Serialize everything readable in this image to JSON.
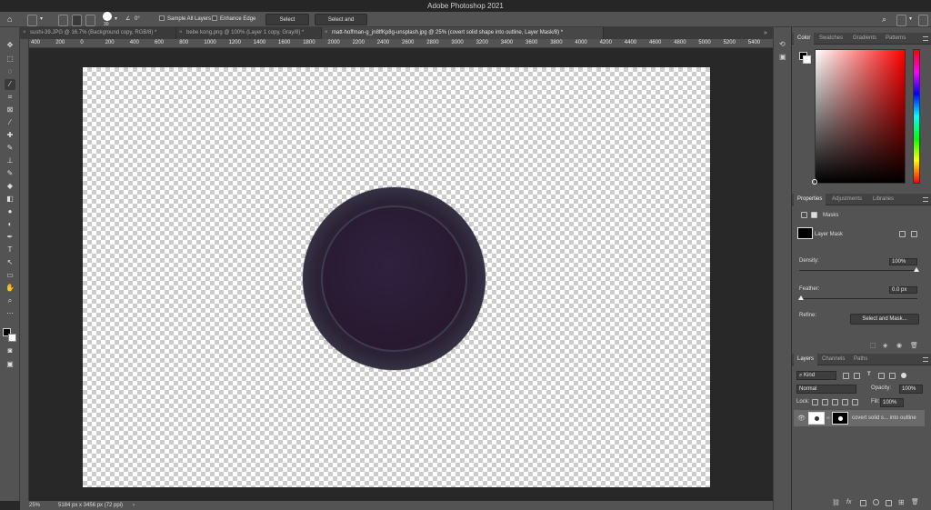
{
  "app": {
    "title": "Adobe Photoshop 2021"
  },
  "options": {
    "brush_size": "30",
    "angle": "0°",
    "sample_all_layers": "Sample All Layers",
    "enhance_edge": "Enhance Edge",
    "select_subject": "Select Subject",
    "select_and_mask": "Select and Mask..."
  },
  "tabs": [
    {
      "label": "sushi-39.JPG @ 16.7% (Background copy, RGB/8) *"
    },
    {
      "label": "bebe kong.png @ 100% (Layer 1 copy, Gray/8) *"
    },
    {
      "label": "matt-hoffman-g_jn8lfKp8g-unsplash.jpg @ 25% (covert solid shape into outline, Layer Mask/8) *"
    }
  ],
  "ruler_ticks": [
    "400",
    "200",
    "0",
    "200",
    "400",
    "600",
    "800",
    "1000",
    "1200",
    "1400",
    "1600",
    "1800",
    "2000",
    "2200",
    "2400",
    "2600",
    "2800",
    "3000",
    "3200",
    "3400",
    "3600",
    "3800",
    "4000",
    "4200",
    "4400",
    "4600",
    "4800",
    "5000",
    "5200",
    "5400"
  ],
  "status": {
    "zoom": "25%",
    "doc_info": "5184 px x 3456 px (72 ppi)"
  },
  "color_panel": {
    "tabs": [
      "Color",
      "Swatches",
      "Gradients",
      "Patterns"
    ],
    "foreground": "#000000",
    "background": "#ffffff"
  },
  "properties_panel": {
    "tabs": [
      "Properties",
      "Adjustments",
      "Libraries"
    ],
    "section": "Masks",
    "mask_type": "Layer Mask",
    "density_label": "Density:",
    "density_value": "100%",
    "feather_label": "Feather:",
    "feather_value": "0.0 px",
    "refine_label": "Refine:",
    "select_and_mask": "Select and Mask..."
  },
  "layers_panel": {
    "tabs": [
      "Layers",
      "Channels",
      "Paths"
    ],
    "filter_kind": "Kind",
    "blend_mode": "Normal",
    "opacity_label": "Opacity:",
    "opacity_value": "100%",
    "lock_label": "Lock:",
    "fill_label": "Fill:",
    "fill_value": "100%",
    "layer_name": "covert solid s... into outline"
  },
  "colors": {
    "accent_disc": "#2a1f38",
    "ui_gray": "#535353"
  }
}
